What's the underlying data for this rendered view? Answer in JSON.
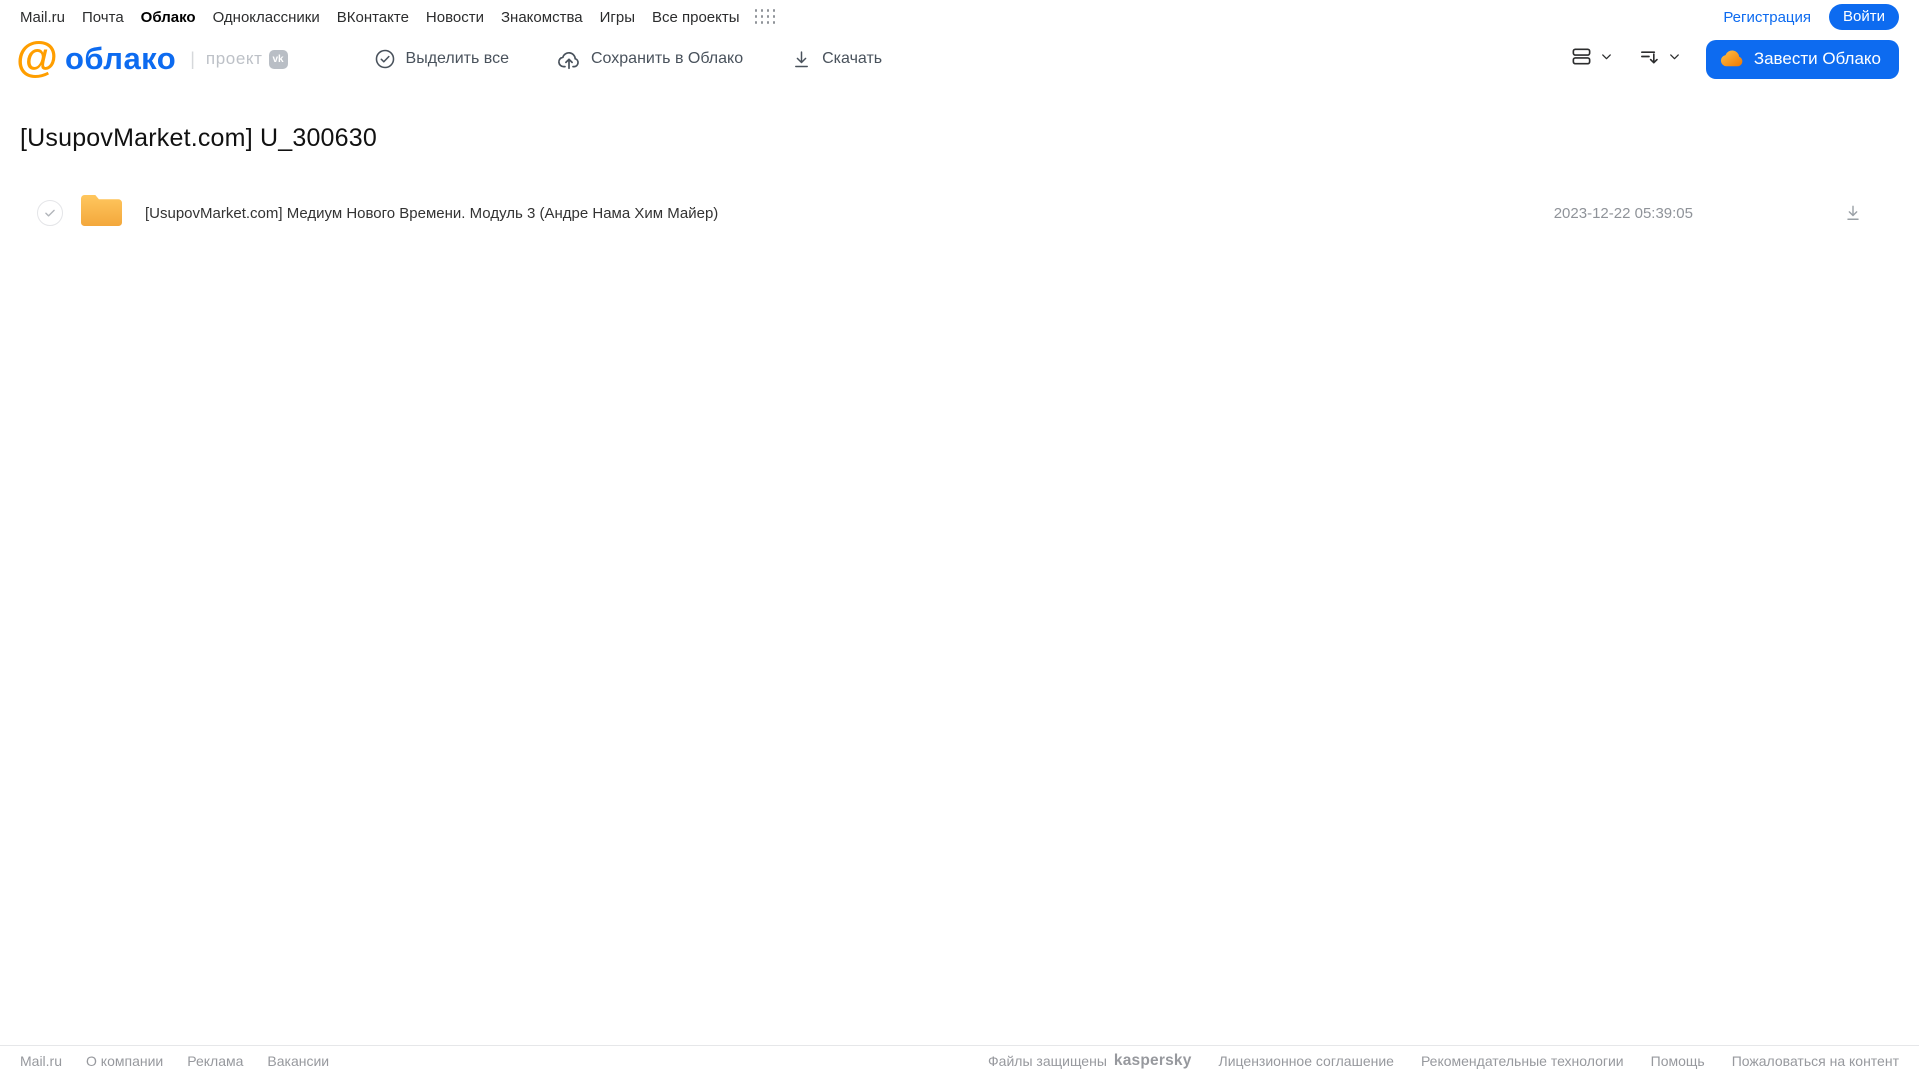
{
  "topbar": {
    "links": [
      "Mail.ru",
      "Почта",
      "Облако",
      "Одноклассники",
      "ВКонтакте",
      "Новости",
      "Знакомства",
      "Игры",
      "Все проекты"
    ],
    "active_link": "Облако",
    "registration_label": "Регистрация",
    "login_label": "Войти"
  },
  "header": {
    "logo_text": "облако",
    "project_label": "проект",
    "vk_badge": "vk",
    "actions": {
      "select_all": "Выделить все",
      "save_to_cloud": "Сохранить в Облако",
      "download": "Скачать"
    },
    "get_cloud_label": "Завести Облако"
  },
  "page": {
    "title": "[UsupovMarket.com] U_300630"
  },
  "file_list": {
    "rows": [
      {
        "type": "folder",
        "checked": true,
        "name": "[UsupovMarket.com] Медиум Нового Времени. Модуль 3 (Андре Нама Хим Майер)",
        "date": "2023-12-22 05:39:05"
      }
    ]
  },
  "footer": {
    "left_links": [
      "Mail.ru",
      "О компании",
      "Реклама",
      "Вакансии"
    ],
    "protected_label": "Файлы защищены",
    "kaspersky_label": "kaspersky",
    "right_links": [
      "Лицензионное соглашение",
      "Рекомендательные технологии",
      "Помощь",
      "Пожаловаться на контент"
    ]
  },
  "colors": {
    "brand_blue": "#0d6bf0",
    "logo_orange": "#ff9e00",
    "folder_yellow_top": "#ffc75e",
    "folder_yellow_bottom": "#f3a83c",
    "kaspersky_green": "#00a88e"
  }
}
